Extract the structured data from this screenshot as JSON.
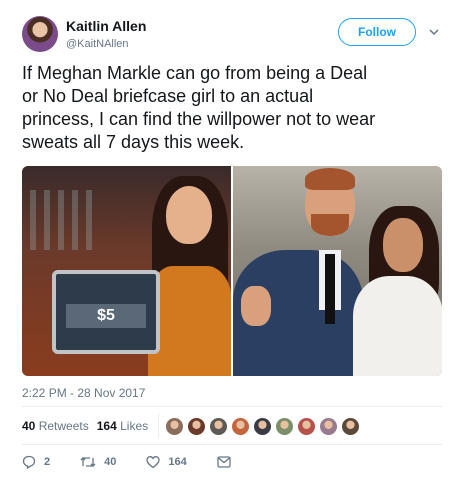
{
  "header": {
    "name": "Kaitlin Allen",
    "handle": "@KaitNAllen",
    "follow_label": "Follow"
  },
  "tweet": {
    "lines": [
      "If Meghan Markle can go from being a Deal",
      "or No Deal briefcase girl to an actual",
      "princess, I can find the willpower not to wear",
      "sweats all 7 days this week."
    ],
    "media": {
      "briefcase_label": "$5"
    },
    "timestamp": "2:22 PM - 28 Nov 2017"
  },
  "stats": {
    "retweets_count": "40",
    "retweets_label": "Retweets",
    "likes_count": "164",
    "likes_label": "Likes",
    "liker_colors": [
      "#8a6d5a",
      "#6a3b2a",
      "#5e5a55",
      "#c4653c",
      "#3b3b45",
      "#7b8f6a",
      "#b7514b",
      "#9a7a8e",
      "#5b4a3a"
    ]
  },
  "actions": {
    "reply_count": "2",
    "retweet_count": "40",
    "like_count": "164"
  },
  "icons": [
    "chevron-down-icon",
    "reply-icon",
    "retweet-icon",
    "like-icon",
    "message-icon"
  ],
  "colors": {
    "accent": "#1da1f2",
    "muted": "#657786",
    "text": "#14171a"
  }
}
